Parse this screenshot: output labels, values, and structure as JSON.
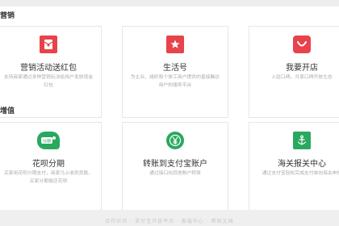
{
  "sections": {
    "marketing": {
      "title": "营销",
      "cards": [
        {
          "name": "营销活动送红包",
          "desc": "支持商家通过多种营销玩法给用户发放现金红包",
          "icon": "red-envelope-icon",
          "color": "#e8434b"
        },
        {
          "name": "生活号",
          "desc": "为企业、组织和个体工商户提供的直接触达用户的服务平台",
          "icon": "star-bookmark-icon",
          "color": "#e8434b"
        },
        {
          "name": "我要开店",
          "desc": "入驻口碑，共享口碑开放生态",
          "icon": "shop-smile-icon",
          "color": "#e8434b"
        }
      ]
    },
    "value_added": {
      "title": "增值",
      "cards": [
        {
          "name": "花呗分期",
          "desc": "买家用花呗分期支付，商家马上收到货款，买家分期偿还花呗",
          "icon": "huabei-icon",
          "color": "#2aa85f"
        },
        {
          "name": "转账到支付宝账户",
          "desc": "通过接口向其他账户转账",
          "icon": "yen-transfer-icon",
          "color": "#2aa85f"
        },
        {
          "name": "海关报关中心",
          "desc": "通过支付宝轻松完成支付单向海关申报",
          "icon": "anchor-icon",
          "color": "#2aa85f"
        }
      ]
    }
  },
  "footer": {
    "text": "合作伙伴 · 支付宝开放平台 · 客服中心 · 帮助文档"
  }
}
